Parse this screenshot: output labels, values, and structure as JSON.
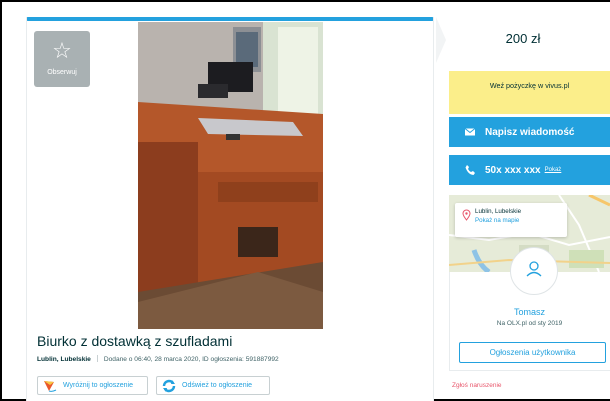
{
  "ad": {
    "observe_label": "Obserwuj",
    "title": "Biurko z dostawką z szufladami",
    "location": "Lublin, Lubelskie",
    "added": "Dodane o 06:40, 28 marca 2020, ID ogłoszenia: 591887992",
    "promo_highlight": "Wyróżnij to ogłoszenie",
    "promo_refresh": "Odśwież to ogłoszenie"
  },
  "sidebar": {
    "price": "200 zł",
    "loan_banner": "Weź pożyczkę w vivus.pl",
    "message_button": "Napisz wiadomość",
    "phone_number": "50x xxx xxx",
    "phone_show": "Pokaż",
    "map_location": "Lublin, Lubelskie",
    "map_show": "Pokaż na mapie",
    "user_name": "Tomasz",
    "user_since": "Na OLX.pl od sty 2019",
    "user_ads_button": "Ogłoszenia użytkownika",
    "report": "Zgłoś naruszenie"
  },
  "colors": {
    "accent": "#23a1de",
    "loan_bg": "#fbee8a",
    "text": "#002f34",
    "report": "#e8566b"
  },
  "icons": [
    "star-icon",
    "envelope-icon",
    "phone-icon",
    "location-pin-icon",
    "user-icon",
    "kite-icon",
    "refresh-icon"
  ]
}
